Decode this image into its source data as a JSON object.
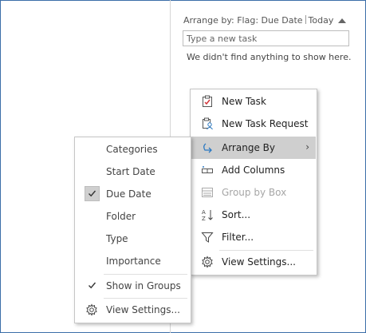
{
  "arrange_header": {
    "prefix": "Arrange by: Flag: Due Date",
    "suffix": "Today"
  },
  "task_input": {
    "placeholder": "Type a new task",
    "value": ""
  },
  "empty_message": "We didn't find anything to show here.",
  "context_menu": {
    "items": [
      {
        "label": "New Task",
        "icon": "task-icon",
        "enabled": true
      },
      {
        "label": "New Task Request",
        "icon": "task-request-icon",
        "enabled": true
      },
      {
        "label": "Arrange By",
        "icon": "arrange-by-icon",
        "enabled": true,
        "highlighted": true,
        "submenu": true
      },
      {
        "label": "Add Columns",
        "icon": "add-columns-icon",
        "enabled": true
      },
      {
        "label": "Group by Box",
        "icon": "group-by-box-icon",
        "enabled": false
      },
      {
        "label": "Sort...",
        "icon": "sort-icon",
        "enabled": true
      },
      {
        "label": "Filter...",
        "icon": "filter-icon",
        "enabled": true
      },
      {
        "label": "View Settings...",
        "icon": "gear-icon",
        "enabled": true
      }
    ]
  },
  "arrange_submenu": {
    "items": [
      {
        "label": "Categories",
        "checked": false
      },
      {
        "label": "Start Date",
        "checked": false
      },
      {
        "label": "Due Date",
        "checked": true
      },
      {
        "label": "Folder",
        "checked": false
      },
      {
        "label": "Type",
        "checked": false
      },
      {
        "label": "Importance",
        "checked": false
      },
      {
        "label": "Show in Groups",
        "checked": true
      },
      {
        "label": "View Settings...",
        "icon": "gear-icon"
      }
    ]
  }
}
